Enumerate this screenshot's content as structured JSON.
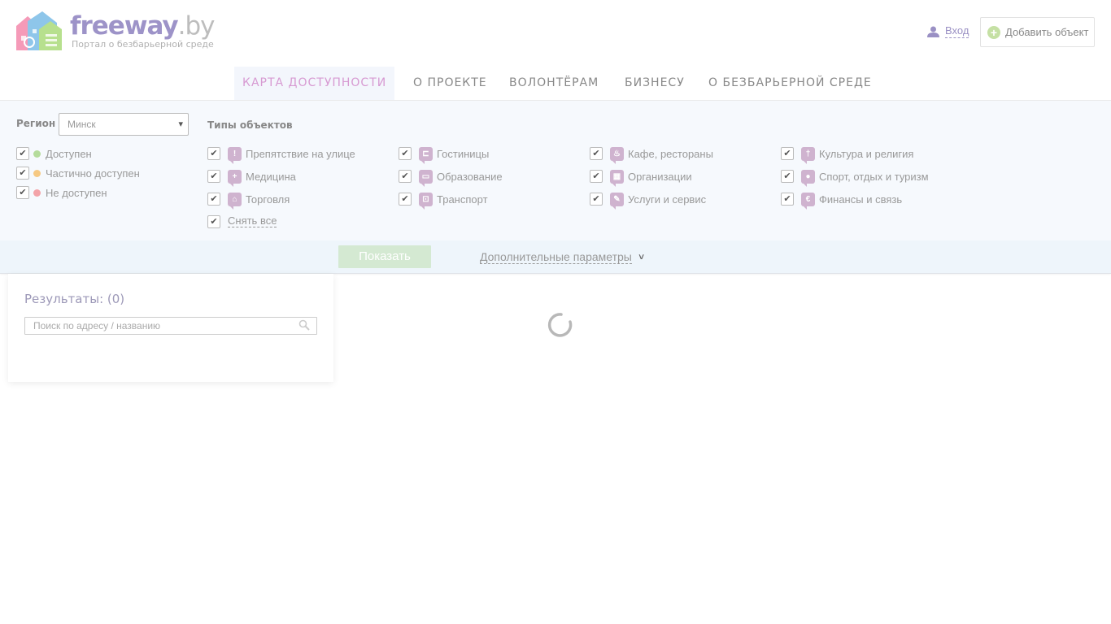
{
  "brand": {
    "name": "freeway",
    "tld": ".by",
    "tagline": "Портал о безбарьерной среде"
  },
  "header": {
    "login_label": "Вход",
    "add_object_label": "Добавить объект"
  },
  "nav": [
    {
      "label": "КАРТА ДОСТУПНОСТИ",
      "active": true
    },
    {
      "label": "О ПРОЕКТЕ"
    },
    {
      "label": "ВОЛОНТЁРАМ"
    },
    {
      "label": "БИЗНЕСУ"
    },
    {
      "label": "О БЕЗБАРЬЕРНОЙ СРЕДЕ"
    }
  ],
  "filters": {
    "region_label": "Регион",
    "region_value": "Минск",
    "types_label": "Типы объектов",
    "accessibility": [
      {
        "label": "Доступен",
        "color": "#b5dc9c",
        "checked": true
      },
      {
        "label": "Частично доступен",
        "color": "#f6c983",
        "checked": true
      },
      {
        "label": "Не доступен",
        "color": "#f3a3a8",
        "checked": true
      }
    ],
    "types": [
      {
        "label": "Препятствие на улице",
        "icon": "exclamation-icon",
        "glyph": "!",
        "checked": true
      },
      {
        "label": "Гостиницы",
        "icon": "bed-icon",
        "glyph": "⊏",
        "checked": true
      },
      {
        "label": "Кафе, рестораны",
        "icon": "cup-icon",
        "glyph": "♨",
        "checked": true
      },
      {
        "label": "Культура и религия",
        "icon": "culture-icon",
        "glyph": "†",
        "checked": true
      },
      {
        "label": "Медицина",
        "icon": "medical-cross-icon",
        "glyph": "+",
        "checked": true
      },
      {
        "label": "Образование",
        "icon": "book-icon",
        "glyph": "▭",
        "checked": true
      },
      {
        "label": "Организации",
        "icon": "building-icon",
        "glyph": "▦",
        "checked": true
      },
      {
        "label": "Спорт, отдых и туризм",
        "icon": "sport-icon",
        "glyph": "●",
        "checked": true
      },
      {
        "label": "Торговля",
        "icon": "shopping-bag-icon",
        "glyph": "⌂",
        "checked": true
      },
      {
        "label": "Транспорт",
        "icon": "bus-icon",
        "glyph": "⊡",
        "checked": true
      },
      {
        "label": "Услуги и сервис",
        "icon": "wrench-icon",
        "glyph": "✎",
        "checked": true
      },
      {
        "label": "Финансы и связь",
        "icon": "euro-icon",
        "glyph": "€",
        "checked": true
      }
    ],
    "uncheck_all_label": "Снять все",
    "show_button_label": "Показать",
    "more_params_label": "Дополнительные параметры"
  },
  "results": {
    "title": "Результаты: (0)",
    "search_placeholder": "Поиск по адресу / названию"
  },
  "colors": {
    "brand_purple": "#9d93c8",
    "active_nav": "#d79ad2",
    "type_icon": "#cfb3cf",
    "show_button": "#d4e9d2"
  }
}
